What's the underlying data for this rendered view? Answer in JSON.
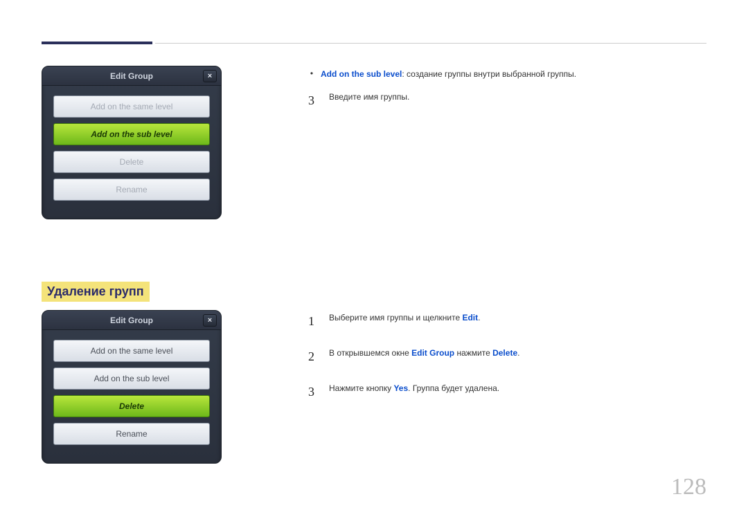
{
  "pageNumber": "128",
  "section1": {
    "dialog": {
      "title": "Edit Group",
      "close": "×",
      "options": {
        "sameLevel": "Add on the same level",
        "subLevel": "Add on the sub level",
        "delete": "Delete",
        "rename": "Rename"
      }
    },
    "right": {
      "bullet_bold": "Add on the sub level",
      "bullet_rest": ": создание группы внутри выбранной группы.",
      "step3_num": "3",
      "step3_text": "Введите имя группы."
    }
  },
  "section2": {
    "title": "Удаление групп",
    "dialog": {
      "title": "Edit Group",
      "close": "×",
      "options": {
        "sameLevel": "Add on the same level",
        "subLevel": "Add on the sub level",
        "delete": "Delete",
        "rename": "Rename"
      }
    },
    "right": {
      "step1_num": "1",
      "step1_a": "Выберите имя группы и щелкните ",
      "step1_b": "Edit",
      "step1_c": ".",
      "step2_num": "2",
      "step2_a": "В открывшемся окне ",
      "step2_b": "Edit Group",
      "step2_c": " нажмите ",
      "step2_d": "Delete",
      "step2_e": ".",
      "step3_num": "3",
      "step3_a": "Нажмите кнопку ",
      "step3_b": "Yes",
      "step3_c": ". Группа будет удалена."
    }
  }
}
